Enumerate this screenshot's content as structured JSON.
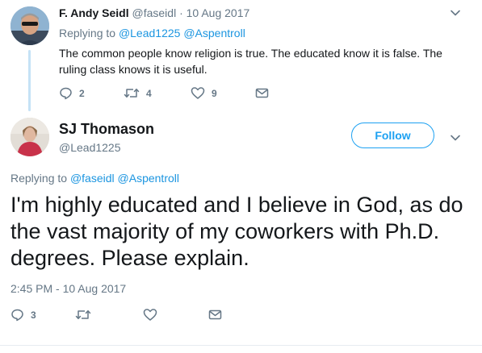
{
  "tweet1": {
    "author_name": "F. Andy Seidl",
    "handle": "@faseidl",
    "separator": " · ",
    "date": "10 Aug 2017",
    "replying_prefix": "Replying to ",
    "replying_users": [
      "@Lead1225",
      "@Aspentroll"
    ],
    "text": "The common people know religion is true. The educated know it is false. The ruling class knows it is useful.",
    "reply_count": "2",
    "retweet_count": "4",
    "like_count": "9"
  },
  "tweet2": {
    "author_name": "SJ Thomason",
    "handle": "@Lead1225",
    "follow_label": "Follow",
    "replying_prefix": "Replying to ",
    "replying_users": [
      "@faseidl",
      "@Aspentroll"
    ],
    "text": "I'm highly educated and I believe in God, as do the vast majority of my coworkers with Ph.D. degrees. Please explain.",
    "timestamp": "2:45 PM - 10 Aug 2017",
    "reply_count": "3"
  },
  "icons": {
    "reply": "reply-icon",
    "retweet": "retweet-icon",
    "like": "heart-icon",
    "dm": "envelope-icon",
    "more": "chevron-down-icon"
  },
  "colors": {
    "link": "#1b95e0",
    "muted": "#657786",
    "follow": "#1da1f2",
    "thread_line": "#c5e2f6"
  }
}
